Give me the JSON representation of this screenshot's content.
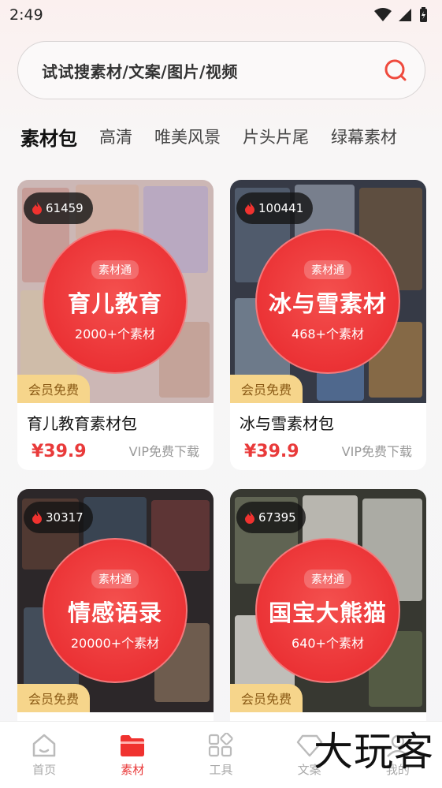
{
  "status_bar": {
    "time": "2:49"
  },
  "search": {
    "placeholder": "试试搜素材/文案/图片/视频"
  },
  "tabs": [
    {
      "label": "素材包",
      "active": true
    },
    {
      "label": "高清",
      "active": false
    },
    {
      "label": "唯美风景",
      "active": false
    },
    {
      "label": "片头片尾",
      "active": false
    },
    {
      "label": "绿幕素材",
      "active": false
    }
  ],
  "cards": [
    {
      "heat": "61459",
      "tag": "素材通",
      "title": "育儿教育",
      "count": "2000+个素材",
      "member": "会员免费",
      "name": "育儿教育素材包",
      "price": "¥39.9",
      "vip": "VIP免费下载"
    },
    {
      "heat": "100441",
      "tag": "素材通",
      "title": "冰与雪素材",
      "count": "468+个素材",
      "member": "会员免费",
      "name": "冰与雪素材包",
      "price": "¥39.9",
      "vip": "VIP免费下载"
    },
    {
      "heat": "30317",
      "tag": "素材通",
      "title": "情感语录",
      "count": "20000+个素材",
      "member": "会员免费",
      "name": "",
      "price": "",
      "vip": ""
    },
    {
      "heat": "67395",
      "tag": "素材通",
      "title": "国宝大熊猫",
      "count": "640+个素材",
      "member": "会员免费",
      "name": "",
      "price": "",
      "vip": ""
    }
  ],
  "bottom_nav": [
    {
      "label": "首页",
      "icon": "home-icon",
      "active": false
    },
    {
      "label": "素材",
      "icon": "folder-icon",
      "active": true
    },
    {
      "label": "工具",
      "icon": "grid-icon",
      "active": false
    },
    {
      "label": "文案",
      "icon": "diamond-icon",
      "active": false
    },
    {
      "label": "我的",
      "icon": "user-icon",
      "active": false
    }
  ],
  "watermark": "大玩客",
  "colors": {
    "accent": "#e93a3a",
    "member_badge": "#f6d58b",
    "circle": "#eb3235"
  }
}
